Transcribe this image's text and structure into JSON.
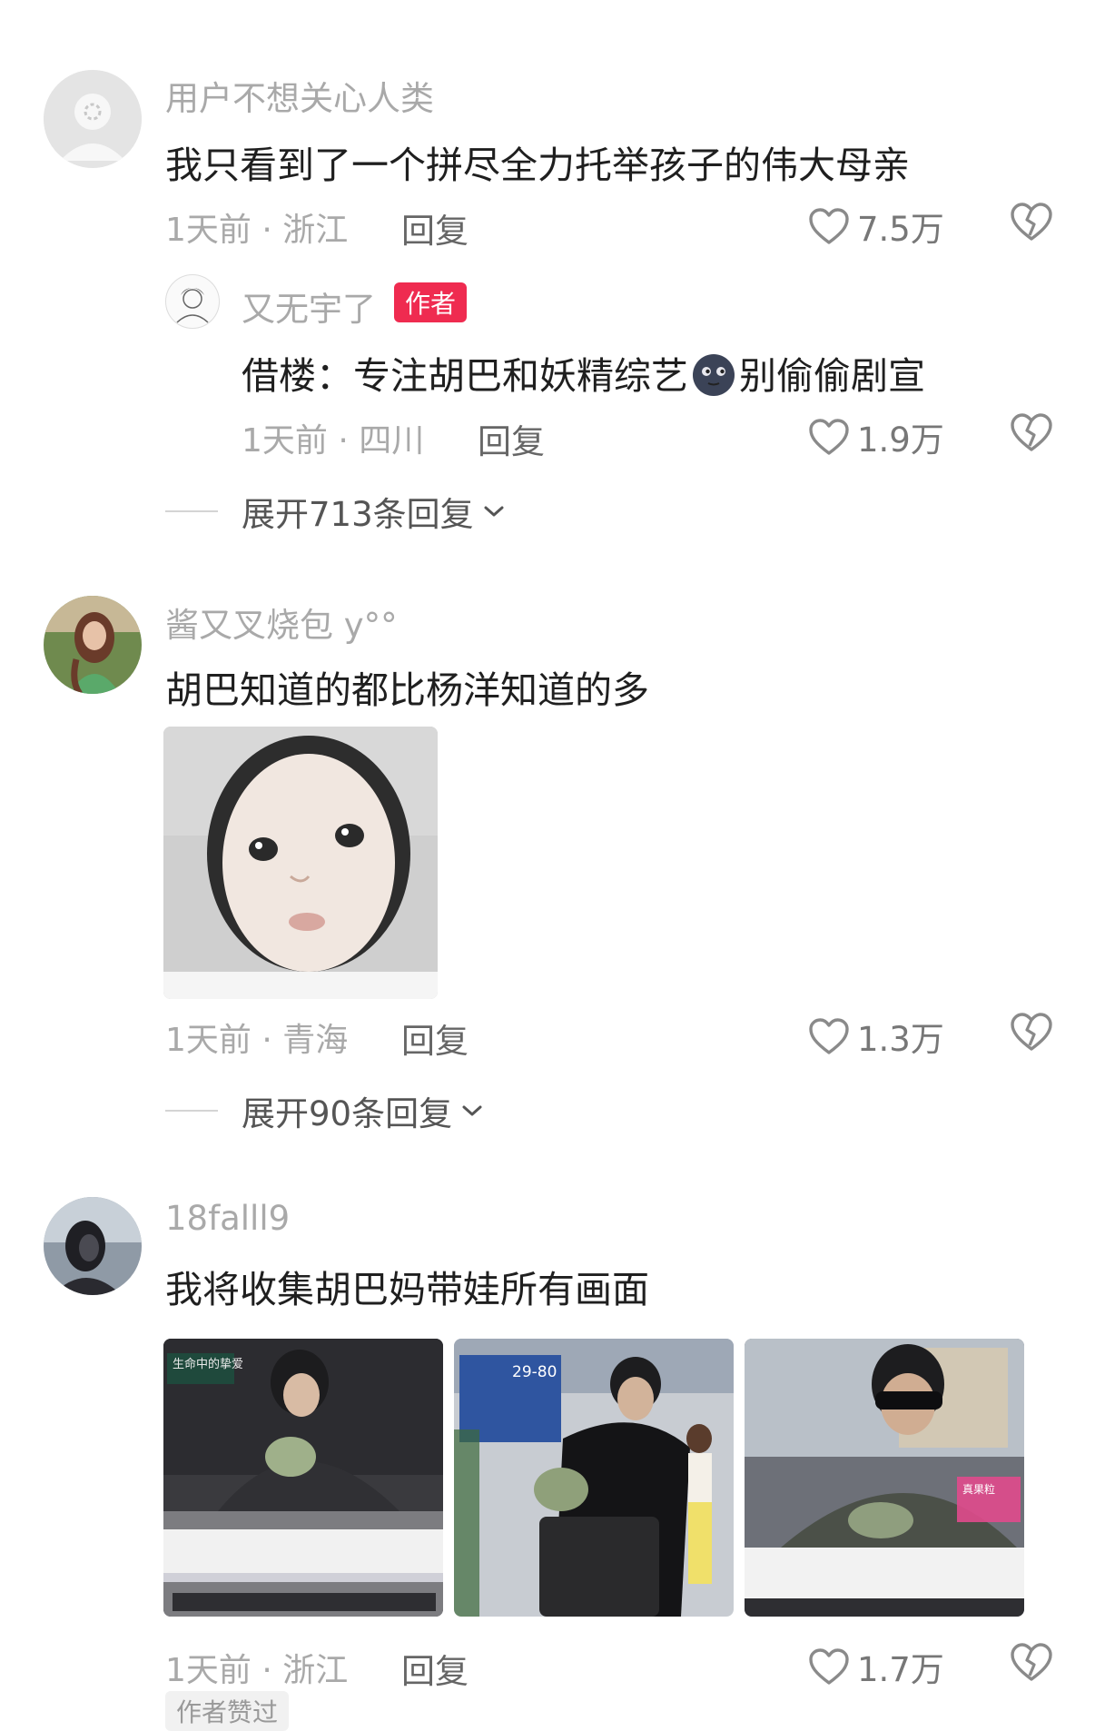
{
  "comments": [
    {
      "username": "用户不想关心人类",
      "text": "我只看到了一个拼尽全力托举孩子的伟大母亲",
      "meta": "1天前 · 浙江",
      "reply_label": "回复",
      "likes": "7.5万",
      "sub_reply": {
        "username": "又无宇了",
        "badge": "作者",
        "text_before": "借楼：专注胡巴和妖精综艺",
        "text_after": "别偷偷剧宣",
        "emoji": "🌚",
        "meta": "1天前 · 四川",
        "reply_label": "回复",
        "likes": "1.9万"
      },
      "expand_label": "展开713条回复"
    },
    {
      "username": "酱又叉烧包 y°°",
      "text": "胡巴知道的都比杨洋知道的多",
      "meta": "1天前 · 青海",
      "reply_label": "回复",
      "likes": "1.3万",
      "expand_label": "展开90条回复"
    },
    {
      "username": "18falll9",
      "text": "我将收集胡巴妈带娃所有画面",
      "meta": "1天前 · 浙江",
      "reply_label": "回复",
      "likes": "1.7万",
      "images": [
        {
          "caption": "生命中的挚爱"
        },
        {
          "caption": "29-80"
        },
        {
          "caption": "真果粒"
        }
      ]
    }
  ],
  "footer_tag": "作者赞过",
  "colors": {
    "badge": "#ef2b50",
    "secondary_text": "#a9a9a9",
    "primary_text": "#1f1f1f"
  },
  "icons": {
    "like": "heart-outline-icon",
    "dislike": "broken-heart-icon",
    "expand": "chevron-down-icon"
  }
}
